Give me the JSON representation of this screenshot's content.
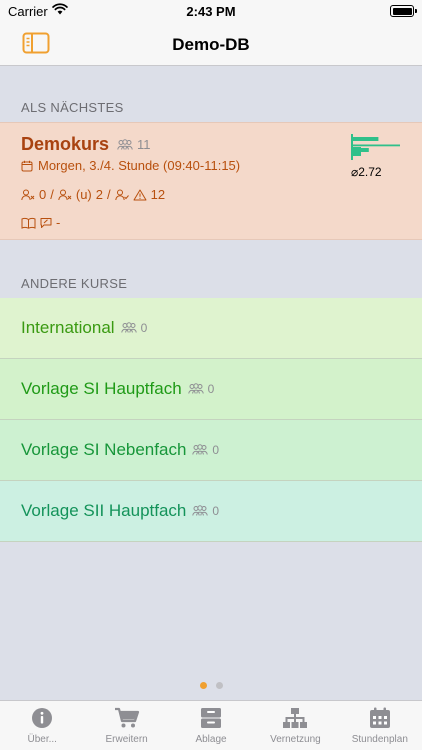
{
  "status_bar": {
    "carrier": "Carrier",
    "time": "2:43 PM"
  },
  "nav": {
    "title": "Demo-DB"
  },
  "sections": {
    "next": "ALS NÄCHSTES",
    "other": "ANDERE KURSE"
  },
  "next_course": {
    "name": "Demokurs",
    "student_count": "11",
    "time": "Morgen, 3./4. Stunde (09:40-11:15)",
    "absent": "0",
    "separator": "/",
    "absent_excused": "2",
    "warnings": "12",
    "book_value": "-",
    "average": "2.72",
    "grade_bars": [
      0.55,
      1.0,
      0.35
    ]
  },
  "courses": [
    {
      "name": "International",
      "count": "0",
      "bg": "#dff3cf",
      "color": "#3a9a12"
    },
    {
      "name": "Vorlage SI Hauptfach",
      "count": "0",
      "bg": "#d3f2cb",
      "color": "#1f9a17"
    },
    {
      "name": "Vorlage SI Nebenfach",
      "count": "0",
      "bg": "#cdf1d1",
      "color": "#17963a"
    },
    {
      "name": "Vorlage SII Hauptfach",
      "count": "0",
      "bg": "#ccf0e2",
      "color": "#14935a"
    }
  ],
  "colors": {
    "accent": "#f0a030",
    "chart": "#2fc08a",
    "dot_active": "#f0a030",
    "dot_inactive": "#c0c0c4"
  },
  "pager": {
    "pages": 2,
    "current": 0
  },
  "tabs": [
    {
      "label": "Über...",
      "icon": "info-icon"
    },
    {
      "label": "Erweitern",
      "icon": "cart-icon"
    },
    {
      "label": "Ablage",
      "icon": "archive-icon"
    },
    {
      "label": "Vernetzung",
      "icon": "network-icon"
    },
    {
      "label": "Stundenplan",
      "icon": "calendar-icon"
    }
  ]
}
